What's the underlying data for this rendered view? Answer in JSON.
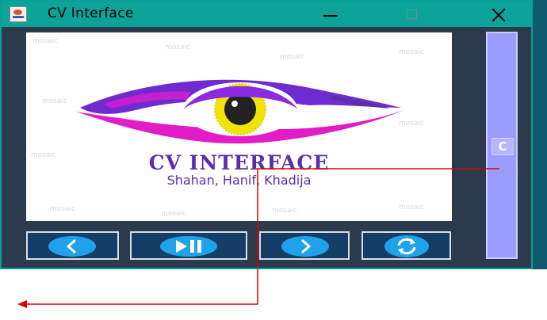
{
  "window": {
    "title": "CV Interface"
  },
  "image_panel": {
    "logo_title": "CV INTERFACE",
    "logo_subtitle": "Shahan, Hanif, Khadija",
    "watermark_text": "mosaic"
  },
  "side_panel": {
    "button_label": "C"
  },
  "controls": {
    "prev_icon": "chevron-left-icon",
    "play_pause_icon": "play-pause-icon",
    "next_icon": "chevron-right-icon",
    "refresh_icon": "refresh-icon"
  },
  "colors": {
    "title_bar": "#0ca398",
    "window_body": "#2b3a4c",
    "control_button": "#163d66",
    "icon_blue": "#1fa2ea",
    "side_panel": "#9b9cff",
    "annotation_arrow": "#e00000",
    "logo_purple": "#5a2fa8",
    "logo_magenta": "#e21cc6",
    "eye_yellow": "#f1e20a"
  }
}
